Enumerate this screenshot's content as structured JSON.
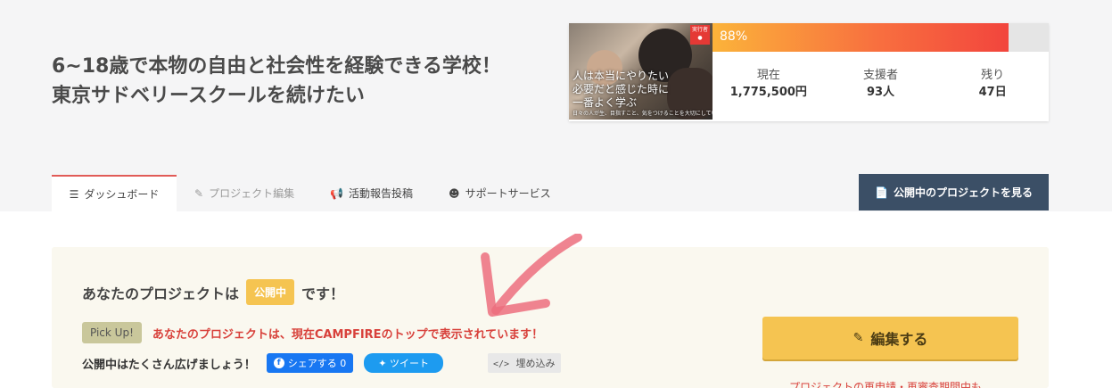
{
  "project": {
    "title_line1": "6~18歳で本物の自由と社会性を経験できる学校！",
    "title_line2": "東京サドベリースクールを続けたい"
  },
  "thumbnail": {
    "overlay_line1": "人は本当にやりたい",
    "overlay_line2": "必要だと感じた時に",
    "overlay_line3": "一番よく学ぶ",
    "caption": "日々の人が生、目指すこと、気をつけることを大切にしています",
    "badge": "実行者"
  },
  "progress": {
    "percent_label": "88%",
    "fraction": 0.88
  },
  "stats": {
    "current_label": "現在",
    "current_value": "1,775,500円",
    "supporters_label": "支援者",
    "supporters_value": "93人",
    "remaining_label": "残り",
    "remaining_value": "47日"
  },
  "tabs": [
    {
      "label": "ダッシュボード",
      "icon": "list-icon"
    },
    {
      "label": "プロジェクト編集",
      "icon": "pencil-icon"
    },
    {
      "label": "活動報告投稿",
      "icon": "megaphone-icon"
    },
    {
      "label": "サポートサービス",
      "icon": "support-icon"
    }
  ],
  "view_button": {
    "label": "公開中のプロジェクトを見る",
    "icon": "document-icon"
  },
  "status": {
    "prefix": "あなたのプロジェクトは",
    "badge": "公開中",
    "suffix": "です！"
  },
  "pickup": {
    "badge": "Pick Up!",
    "text": "あなたのプロジェクトは、現在CAMPFIREのトップで表示されています！"
  },
  "share": {
    "label": "公開中はたくさん広げましょう！",
    "facebook_label": "シェアする 0",
    "twitter_label": "ツイート",
    "embed_label": "埋め込み"
  },
  "edit_button": {
    "label": "編集する",
    "icon": "pencil-icon"
  },
  "note": {
    "text": "プロジェクトの再申請・再審査期間中も"
  },
  "colors": {
    "accent_red": "#e15b57",
    "badge_yellow": "#f5c451",
    "nav_dark": "#3b4f66",
    "arrow_pink": "#ec6f7e"
  }
}
